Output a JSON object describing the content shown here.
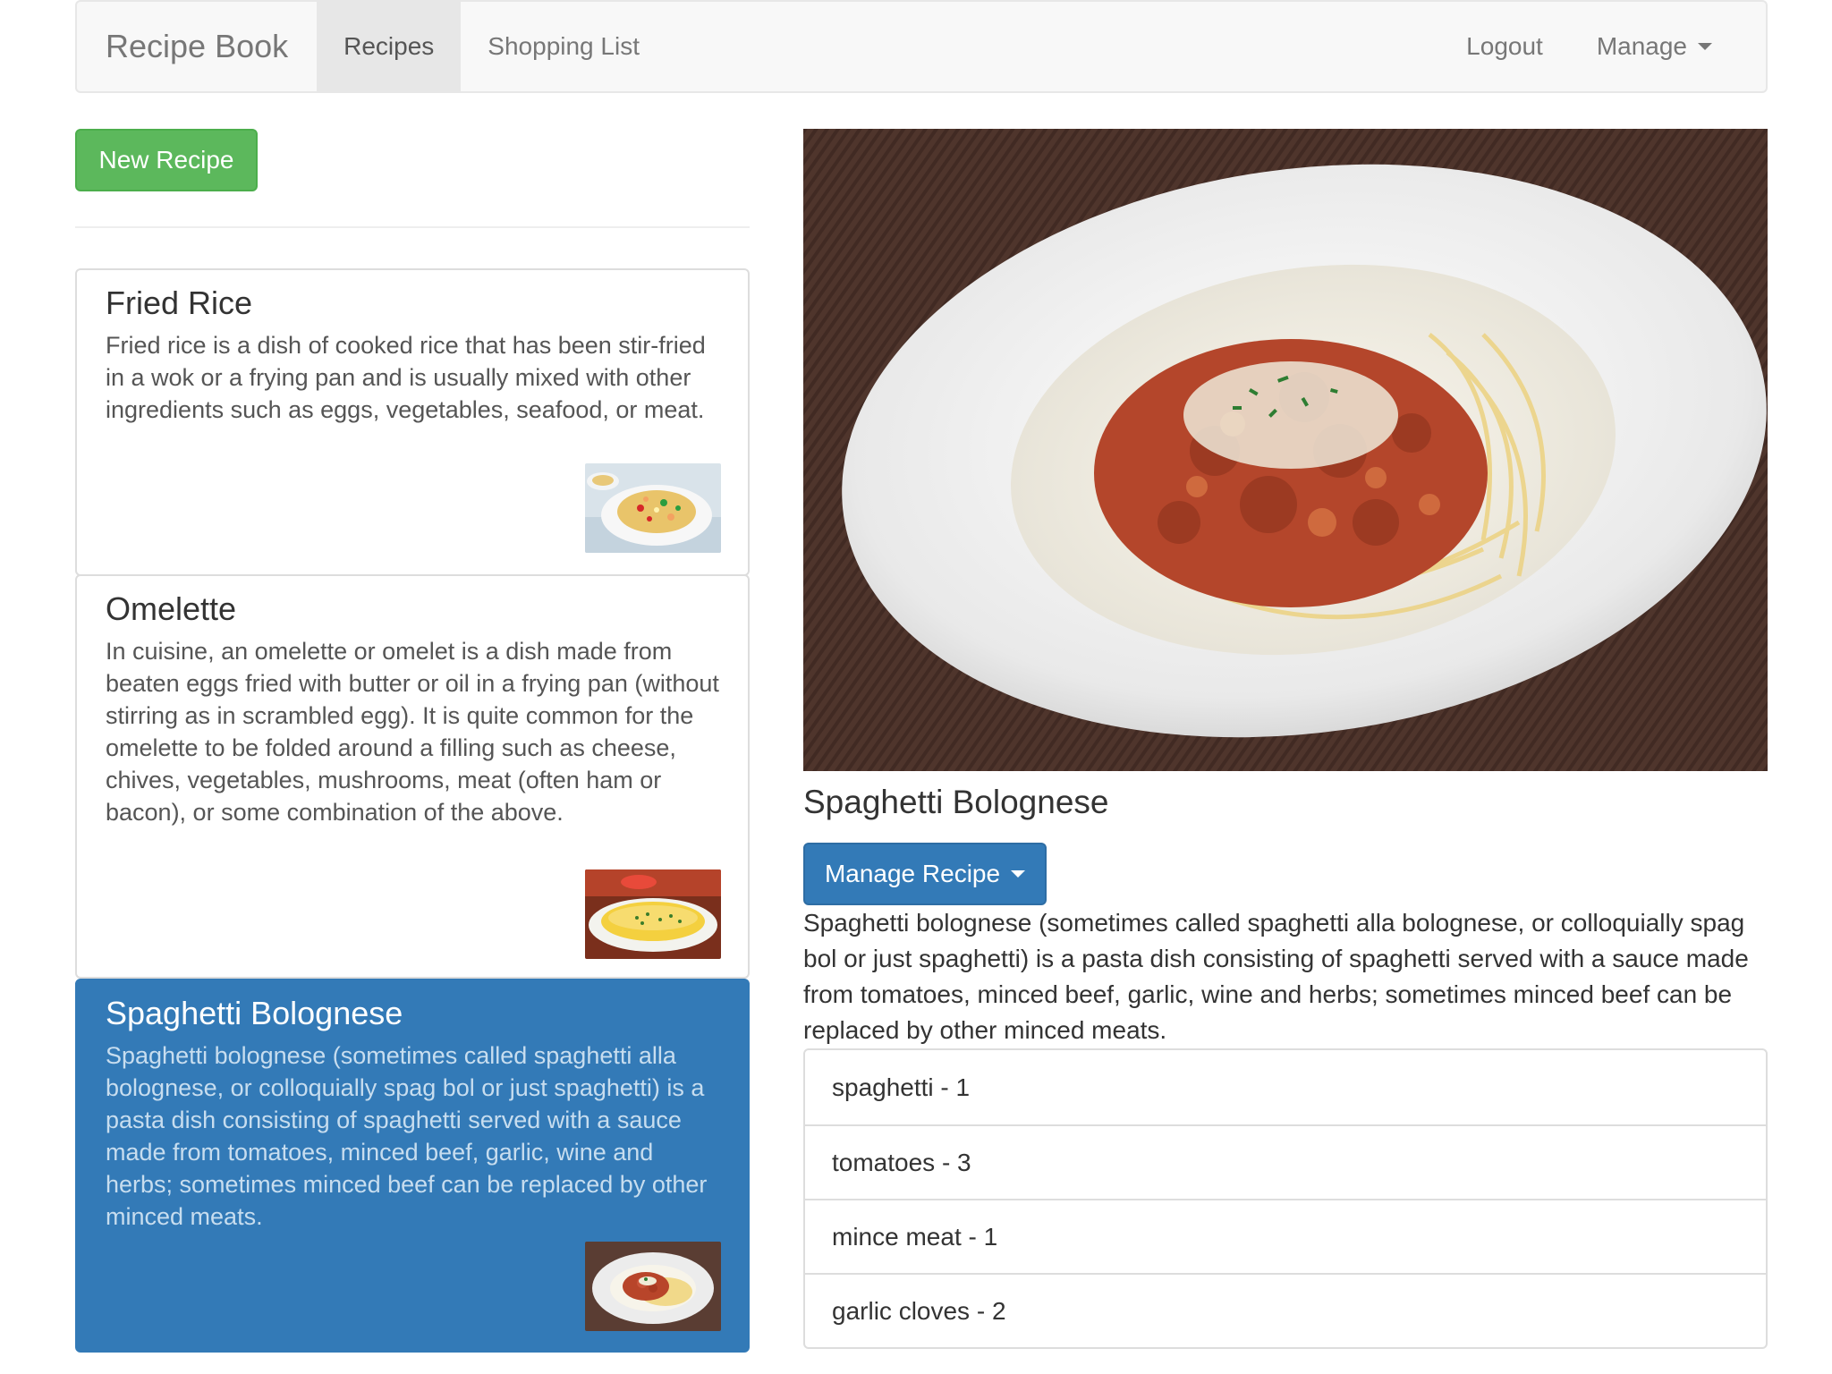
{
  "navbar": {
    "brand": "Recipe Book",
    "links": [
      "Recipes",
      "Shopping List"
    ],
    "active_link": "Recipes",
    "right_links": [
      "Logout",
      "Manage"
    ]
  },
  "sidebar": {
    "new_button_label": "New Recipe",
    "recipes": [
      {
        "name": "Fried Rice",
        "description": "Fried rice is a dish of cooked rice that has been stir-fried in a wok or a frying pan and is usually mixed with other ingredients such as eggs, vegetables, seafood, or meat.",
        "active": false
      },
      {
        "name": "Omelette",
        "description": "In cuisine, an omelette or omelet is a dish made from beaten eggs fried with butter or oil in a frying pan (without stirring as in scrambled egg). It is quite common for the omelette to be folded around a filling such as cheese, chives, vegetables, mushrooms, meat (often ham or bacon), or some combination of the above.",
        "active": false
      },
      {
        "name": "Spaghetti Bolognese",
        "description": "Spaghetti bolognese (sometimes called spaghetti alla bolognese, or colloquially spag bol or just spaghetti) is a pasta dish consisting of spaghetti served with a sauce made from tomatoes, minced beef, garlic, wine and herbs; sometimes minced beef can be replaced by other minced meats.",
        "active": true
      }
    ]
  },
  "detail": {
    "title": "Spaghetti Bolognese",
    "manage_button_label": "Manage Recipe",
    "description": "Spaghetti bolognese (sometimes called spaghetti alla bolognese, or colloquially spag bol or just spaghetti) is a pasta dish consisting of spaghetti served with a sauce made from tomatoes, minced beef, garlic, wine and herbs; sometimes minced beef can be replaced by other minced meats.",
    "ingredients": [
      "spaghetti - 1",
      "tomatoes - 3",
      "mince meat - 1",
      "garlic cloves - 2"
    ]
  },
  "colors": {
    "success": "#5cb85c",
    "primary": "#337ab7",
    "navbar_bg": "#f8f8f8"
  }
}
